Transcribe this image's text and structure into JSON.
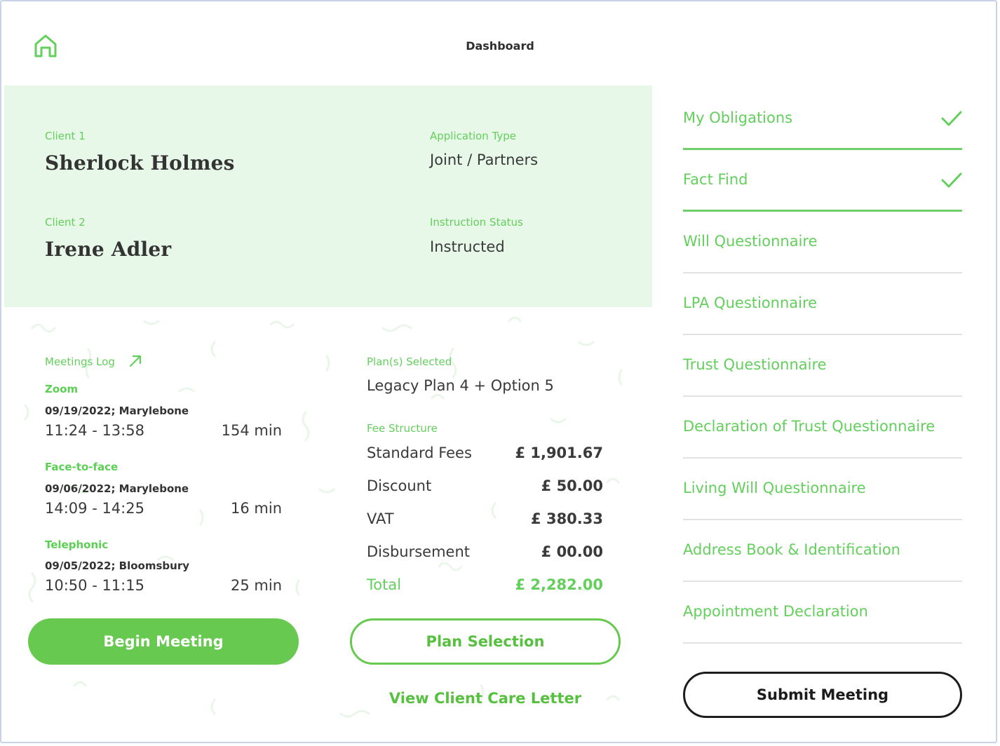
{
  "header": {
    "title": "Dashboard",
    "home_icon": "home-icon"
  },
  "client": {
    "client1_label": "Client 1",
    "client1_name": "Sherlock Holmes",
    "client2_label": "Client 2",
    "client2_name": "Irene Adler",
    "app_type_label": "Application Type",
    "app_type_value": "Joint / Partners",
    "status_label": "Instruction Status",
    "status_value": "Instructed"
  },
  "meetings": {
    "label": "Meetings Log",
    "items": [
      {
        "type": "Zoom",
        "date": "09/19/2022; Marylebone",
        "time": "11:24 - 13:58",
        "duration": "154 min"
      },
      {
        "type": "Face-to-face",
        "date": "09/06/2022; Marylebone",
        "time": "14:09 - 14:25",
        "duration": "16 min"
      },
      {
        "type": "Telephonic",
        "date": "09/05/2022; Bloomsbury",
        "time": "10:50 - 11:15",
        "duration": "25 min"
      }
    ]
  },
  "plan": {
    "label": "Plan(s) Selected",
    "value": "Legacy Plan 4 + Option 5",
    "fee_label": "Fee Structure",
    "fees": [
      {
        "label": "Standard Fees",
        "value": "£ 1,901.67"
      },
      {
        "label": "Discount",
        "value": "£ 50.00"
      },
      {
        "label": "VAT",
        "value": "£ 380.33"
      },
      {
        "label": "Disbursement",
        "value": "£ 00.00"
      },
      {
        "label": "Total",
        "value": "£ 2,282.00"
      }
    ]
  },
  "actions": {
    "begin_meeting": "Begin Meeting",
    "plan_selection": "Plan Selection",
    "view_care_letter": "View Client Care Letter",
    "submit_meeting": "Submit Meeting"
  },
  "tasks": [
    {
      "label": "My Obligations",
      "done": true
    },
    {
      "label": "Fact Find",
      "done": true
    },
    {
      "label": "Will Questionnaire",
      "done": false
    },
    {
      "label": "LPA Questionnaire",
      "done": false
    },
    {
      "label": "Trust Questionnaire",
      "done": false
    },
    {
      "label": "Declaration of  Trust Questionnaire",
      "done": false
    },
    {
      "label": "Living Will Questionnaire",
      "done": false
    },
    {
      "label": "Address Book & Identification",
      "done": false
    },
    {
      "label": "Appointment Declaration",
      "done": false
    }
  ],
  "colors": {
    "accent": "#63cf5c",
    "panel": "#e7f7e8",
    "button": "#67c94f"
  }
}
